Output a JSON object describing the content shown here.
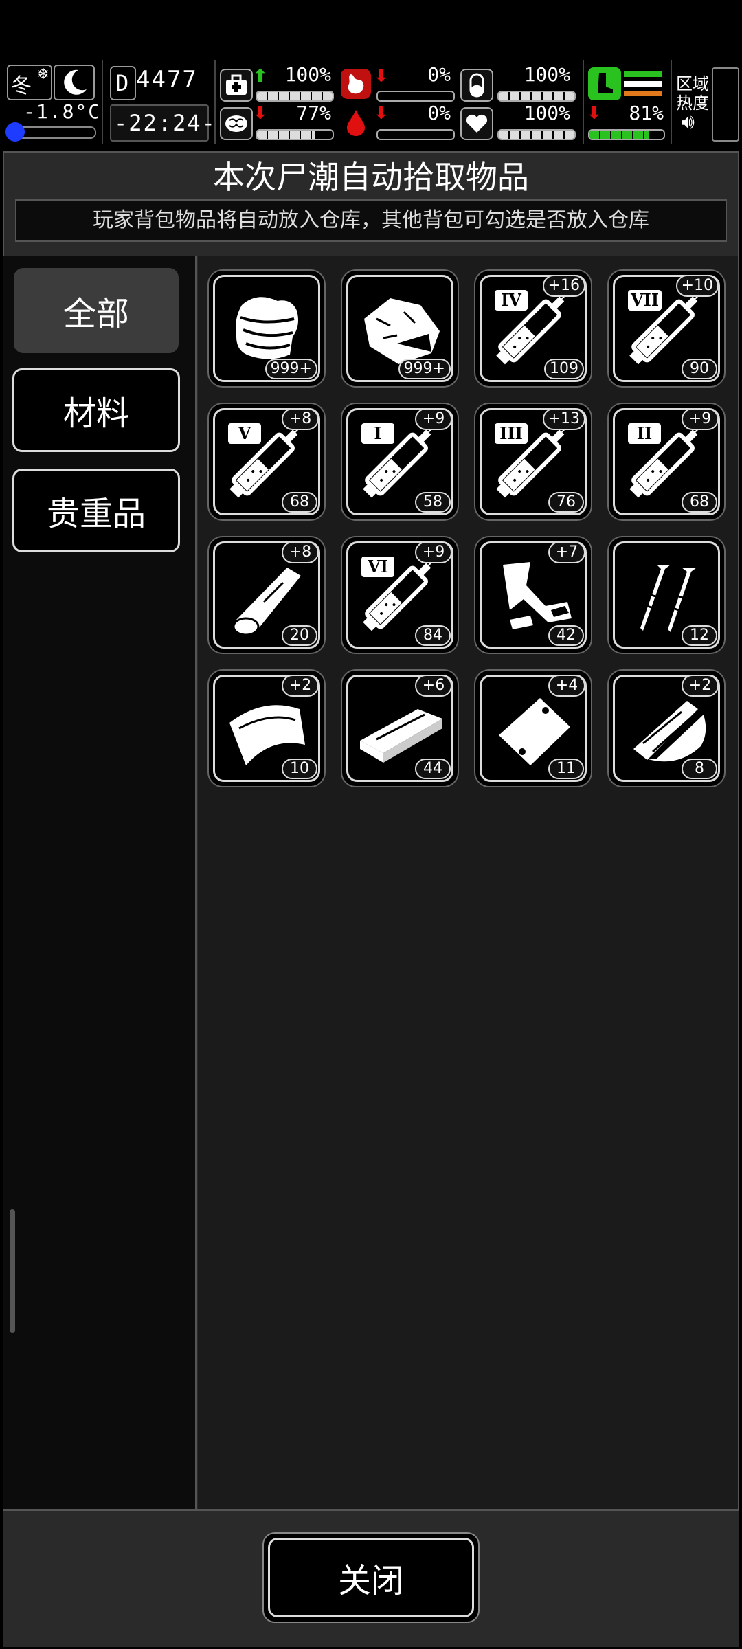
{
  "status": {
    "season": "冬",
    "temperature": "-1.8°C",
    "day_counter": "4477",
    "day_prefix": "D",
    "clock": "-22:24-",
    "stats": [
      {
        "name": "health",
        "value": "100%",
        "trend": "up"
      },
      {
        "name": "hunger",
        "value": "0%",
        "trend": "down"
      },
      {
        "name": "mood",
        "value": "100%",
        "trend": "none"
      },
      {
        "name": "sanity",
        "value": "77%",
        "trend": "down"
      },
      {
        "name": "thirst",
        "value": "0%",
        "trend": "down"
      },
      {
        "name": "heart",
        "value": "100%",
        "trend": "none"
      },
      {
        "name": "stamina",
        "value": "81%",
        "trend": "down"
      }
    ],
    "zone_label": "区域\n热度",
    "zone_line1": "区域",
    "zone_line2": "热度",
    "colors": {
      "green": "#29c21e",
      "red": "#e01010",
      "orange": "#e07a1c",
      "blue": "#1e3cff"
    }
  },
  "dialog": {
    "title": "本次尸潮自动拾取物品",
    "subtitle": "玩家背包物品将自动放入仓库，其他背包可勾选是否放入仓库",
    "tabs": [
      {
        "label": "全部",
        "active": true
      },
      {
        "label": "材料",
        "active": false
      },
      {
        "label": "贵重品",
        "active": false
      }
    ],
    "items": [
      {
        "icon": "cloth-icon",
        "count": "999+",
        "bonus": "",
        "roman": ""
      },
      {
        "icon": "meat-icon",
        "count": "999+",
        "bonus": "",
        "roman": ""
      },
      {
        "icon": "syringe-icon",
        "count": "109",
        "bonus": "+16",
        "roman": "IV"
      },
      {
        "icon": "syringe-icon",
        "count": "90",
        "bonus": "+10",
        "roman": "VII"
      },
      {
        "icon": "syringe-icon",
        "count": "68",
        "bonus": "+8",
        "roman": "V"
      },
      {
        "icon": "syringe-icon",
        "count": "58",
        "bonus": "+9",
        "roman": "I"
      },
      {
        "icon": "syringe-icon",
        "count": "76",
        "bonus": "+13",
        "roman": "III"
      },
      {
        "icon": "syringe-icon",
        "count": "68",
        "bonus": "+9",
        "roman": "II"
      },
      {
        "icon": "wood-log-icon",
        "count": "20",
        "bonus": "+8",
        "roman": ""
      },
      {
        "icon": "syringe-icon",
        "count": "84",
        "bonus": "+9",
        "roman": "VI"
      },
      {
        "icon": "scrap-metal-icon",
        "count": "42",
        "bonus": "+7",
        "roman": ""
      },
      {
        "icon": "nails-icon",
        "count": "12",
        "bonus": "",
        "roman": ""
      },
      {
        "icon": "fabric-sheet-icon",
        "count": "10",
        "bonus": "+2",
        "roman": ""
      },
      {
        "icon": "wood-plank-icon",
        "count": "44",
        "bonus": "+6",
        "roman": ""
      },
      {
        "icon": "plastic-bag-icon",
        "count": "11",
        "bonus": "+4",
        "roman": ""
      },
      {
        "icon": "glass-shards-icon",
        "count": "8",
        "bonus": "+2",
        "roman": ""
      }
    ],
    "close_label": "关闭"
  }
}
